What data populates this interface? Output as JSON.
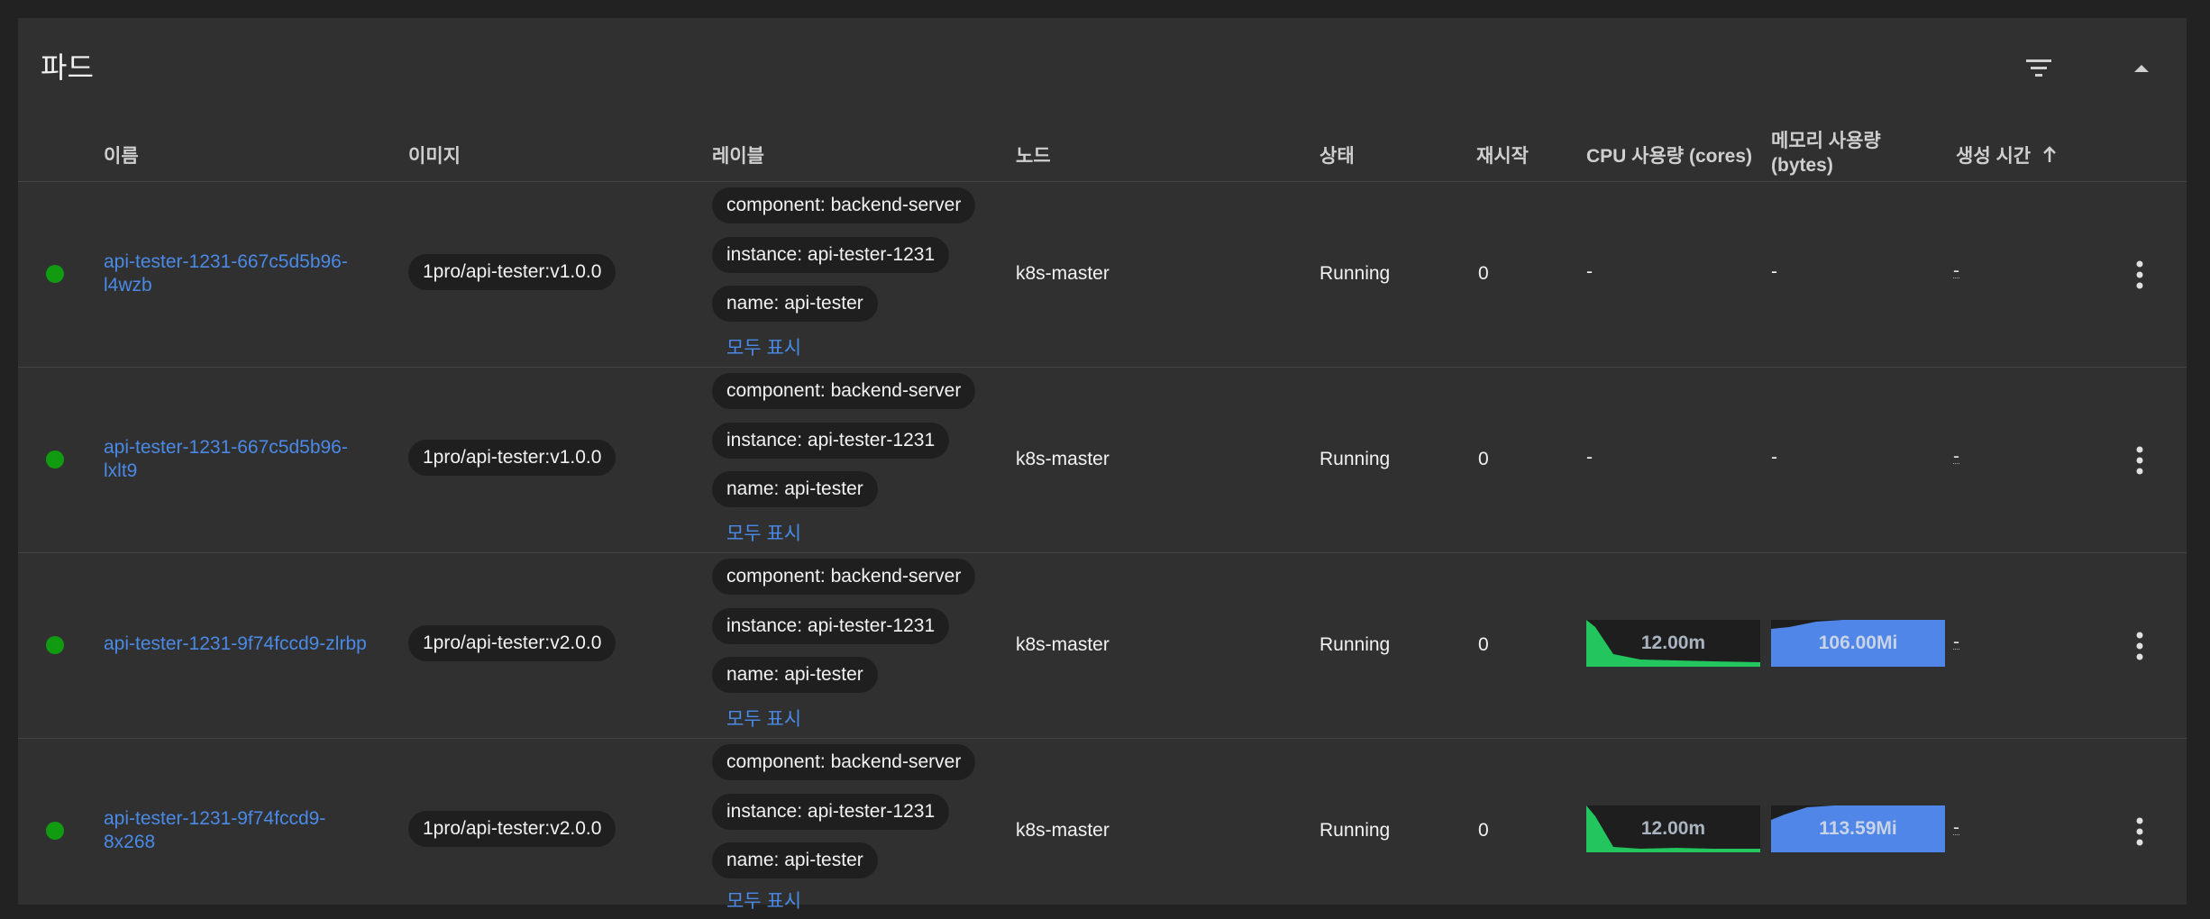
{
  "card": {
    "title": "파드"
  },
  "header_icons": {
    "filter": "filter-icon",
    "collapse": "expand-less-icon"
  },
  "columns": {
    "name": "이름",
    "image": "이미지",
    "labels": "레이블",
    "node": "노드",
    "status": "상태",
    "restarts": "재시작",
    "cpu": "CPU 사용량 (cores)",
    "memory_line1": "메모리 사용량",
    "memory_line2": "(bytes)",
    "created": "생성 시간",
    "created_sort_icon": "arrow-up-icon"
  },
  "colors": {
    "status_running": "#109b10",
    "link": "#4a8ae6",
    "cpu_spark": "#22c55e",
    "mem_spark": "#4f86e8"
  },
  "rows": [
    {
      "name_line1": "api-tester-1231-667c5d5b96-",
      "name_line2": "l4wzb",
      "image": "1pro/api-tester:v1.0.0",
      "labels": [
        "component: backend-server",
        "instance: api-tester-1231",
        "name: api-tester"
      ],
      "show_all": "모두 표시",
      "node": "k8s-master",
      "status": "Running",
      "restarts": "0",
      "cpu": "-",
      "memory": "-",
      "created": "-"
    },
    {
      "name_line1": "api-tester-1231-667c5d5b96-",
      "name_line2": "lxlt9",
      "image": "1pro/api-tester:v1.0.0",
      "labels": [
        "component: backend-server",
        "instance: api-tester-1231",
        "name: api-tester"
      ],
      "show_all": "모두 표시",
      "node": "k8s-master",
      "status": "Running",
      "restarts": "0",
      "cpu": "-",
      "memory": "-",
      "created": "-"
    },
    {
      "name_line1": "api-tester-1231-9f74fccd9-zlrbp",
      "name_line2": "",
      "image": "1pro/api-tester:v2.0.0",
      "labels": [
        "component: backend-server",
        "instance: api-tester-1231",
        "name: api-tester"
      ],
      "show_all": "모두 표시",
      "node": "k8s-master",
      "status": "Running",
      "restarts": "0",
      "cpu": "12.00m",
      "memory": "106.00Mi",
      "created": "-"
    },
    {
      "name_line1": "api-tester-1231-9f74fccd9-",
      "name_line2": "8x268",
      "image": "1pro/api-tester:v2.0.0",
      "labels": [
        "component: backend-server",
        "instance: api-tester-1231",
        "name: api-tester"
      ],
      "show_all": "모두 표시",
      "node": "k8s-master",
      "status": "Running",
      "restarts": "0",
      "cpu": "12.00m",
      "memory": "113.59Mi",
      "created": "-"
    }
  ]
}
